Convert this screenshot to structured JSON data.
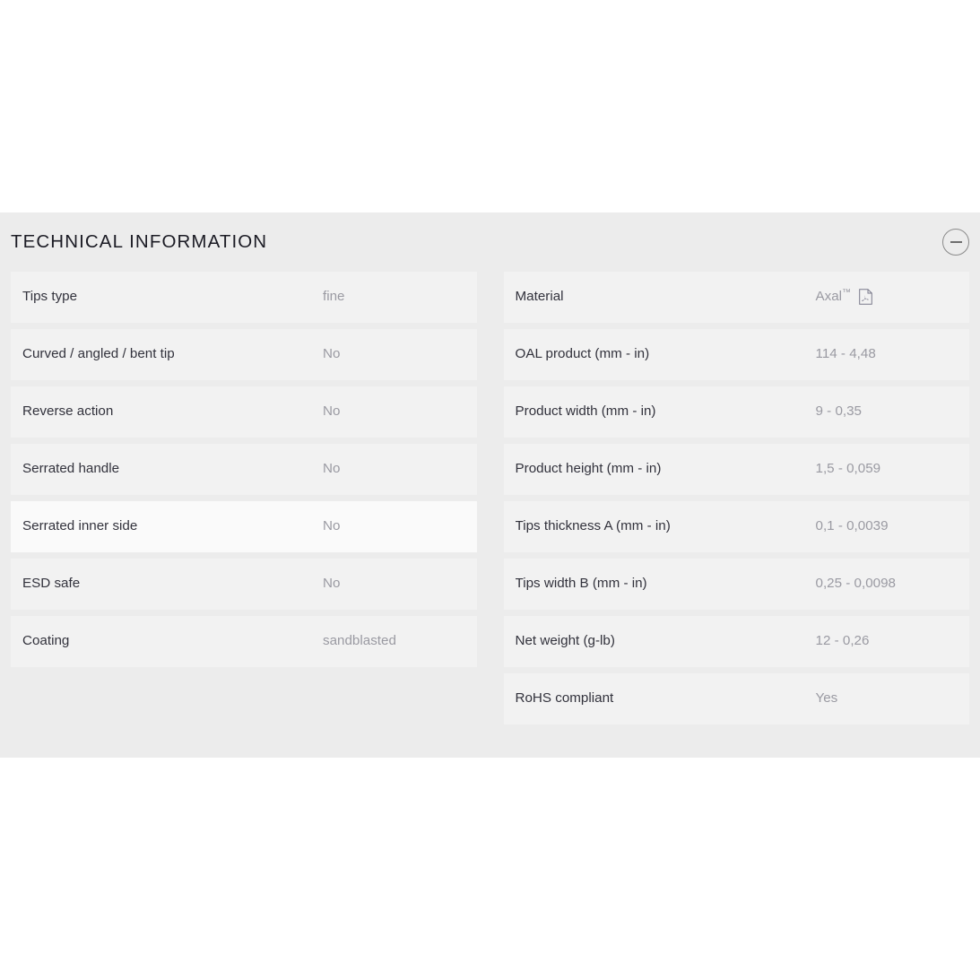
{
  "panel": {
    "title": "TECHNICAL INFORMATION",
    "collapse_icon": "minus-circle-icon",
    "collapsed": false
  },
  "colors": {
    "page_background": "#ffffff",
    "panel_background": "#ececec",
    "row_background": "#f2f2f2",
    "row_highlight_background": "#fafafa",
    "label_text": "#32323c",
    "value_text": "#9a9aa2",
    "title_text": "#1b1b24",
    "icon_border": "#8a8a8a"
  },
  "left_column": [
    {
      "label": "Tips type",
      "value": "fine",
      "highlight": false
    },
    {
      "label": "Curved / angled / bent tip",
      "value": "No",
      "highlight": false
    },
    {
      "label": "Reverse action",
      "value": "No",
      "highlight": false
    },
    {
      "label": "Serrated handle",
      "value": "No",
      "highlight": false
    },
    {
      "label": "Serrated inner side",
      "value": "No",
      "highlight": true
    },
    {
      "label": "ESD safe",
      "value": "No",
      "highlight": false
    },
    {
      "label": "Coating",
      "value": "sandblasted",
      "highlight": false
    }
  ],
  "right_column": [
    {
      "label": "Material",
      "value": "Axal",
      "trademark": "™",
      "icon": "pdf-file-icon",
      "highlight": false
    },
    {
      "label": "OAL product (mm - in)",
      "value": "114 - 4,48",
      "highlight": false
    },
    {
      "label": "Product width (mm - in)",
      "value": "9 - 0,35",
      "highlight": false
    },
    {
      "label": "Product height (mm - in)",
      "value": "1,5 - 0,059",
      "highlight": false
    },
    {
      "label": "Tips thickness A (mm - in)",
      "value": "0,1 - 0,0039",
      "highlight": false
    },
    {
      "label": "Tips width B (mm - in)",
      "value": "0,25 - 0,0098",
      "highlight": false
    },
    {
      "label": "Net weight (g-lb)",
      "value": "12 - 0,26",
      "highlight": false
    },
    {
      "label": "RoHS compliant",
      "value": "Yes",
      "highlight": false
    }
  ]
}
